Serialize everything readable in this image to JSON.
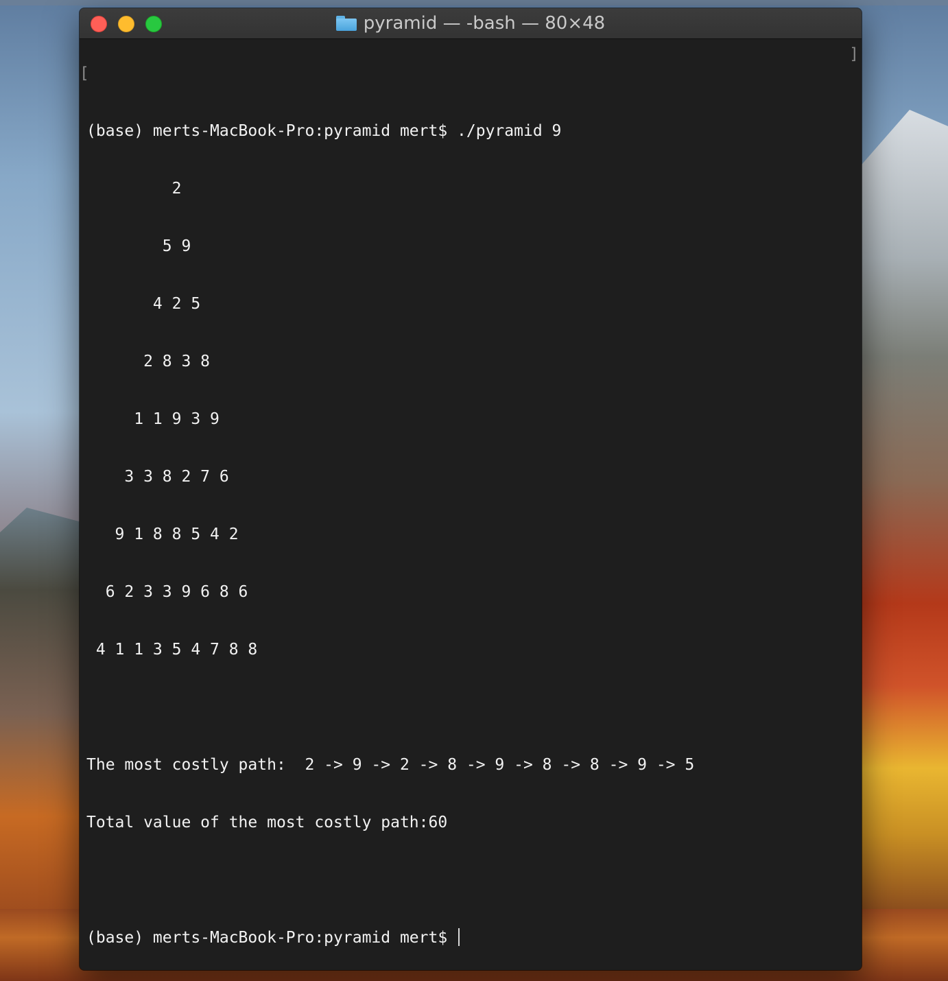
{
  "window": {
    "title": "pyramid — -bash — 80×48",
    "folder_icon": "folder-icon"
  },
  "terminal": {
    "lines": [
      "(base) merts-MacBook-Pro:pyramid mert$ ./pyramid 9",
      "         2",
      "        5 9",
      "       4 2 5",
      "      2 8 3 8",
      "     1 1 9 3 9",
      "    3 3 8 2 7 6",
      "   9 1 8 8 5 4 2",
      "  6 2 3 3 9 6 8 6",
      " 4 1 1 3 5 4 7 8 8",
      "",
      "The most costly path:  2 -> 9 -> 2 -> 8 -> 9 -> 8 -> 8 -> 9 -> 5",
      "Total value of the most costly path:60",
      "",
      "(base) merts-MacBook-Pro:pyramid mert$ "
    ],
    "bracket_left": "[",
    "bracket_right": "]"
  }
}
